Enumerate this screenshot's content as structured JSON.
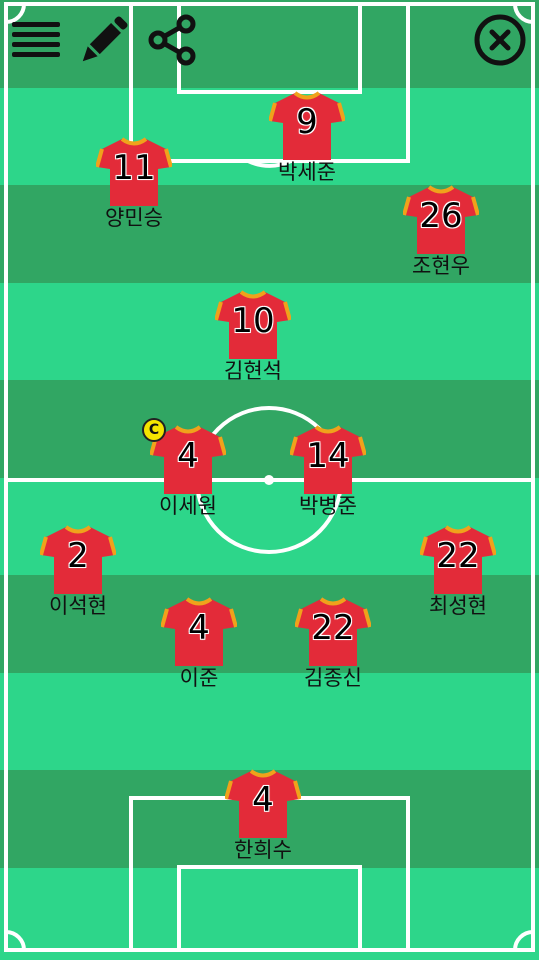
{
  "toolbar": {
    "menu_icon": "hamburger-menu-icon",
    "edit_icon": "pencil-icon",
    "share_icon": "share-icon",
    "close_icon": "close-circle-icon"
  },
  "colors": {
    "pitch_light": "#2dd68a",
    "pitch_dark": "#31a663",
    "line": "#ffffff",
    "shirt": "#e32b39",
    "shirt_trim": "#f0a21b",
    "captain_badge": "#f5e400"
  },
  "players": [
    {
      "id": "p9",
      "number": "9",
      "name": "박세준"
    },
    {
      "id": "p11",
      "number": "11",
      "name": "양민승"
    },
    {
      "id": "p26",
      "number": "26",
      "name": "조현우"
    },
    {
      "id": "p10",
      "number": "10",
      "name": "김현석"
    },
    {
      "id": "p4a",
      "number": "4",
      "name": "이세원",
      "captain": true,
      "captain_mark": "C"
    },
    {
      "id": "p14",
      "number": "14",
      "name": "박병준"
    },
    {
      "id": "p2",
      "number": "2",
      "name": "이석현"
    },
    {
      "id": "p22a",
      "number": "22",
      "name": "최성현"
    },
    {
      "id": "p4b",
      "number": "4",
      "name": "이준"
    },
    {
      "id": "p22b",
      "number": "22",
      "name": "김종신"
    },
    {
      "id": "p4c",
      "number": "4",
      "name": "한희수"
    }
  ]
}
